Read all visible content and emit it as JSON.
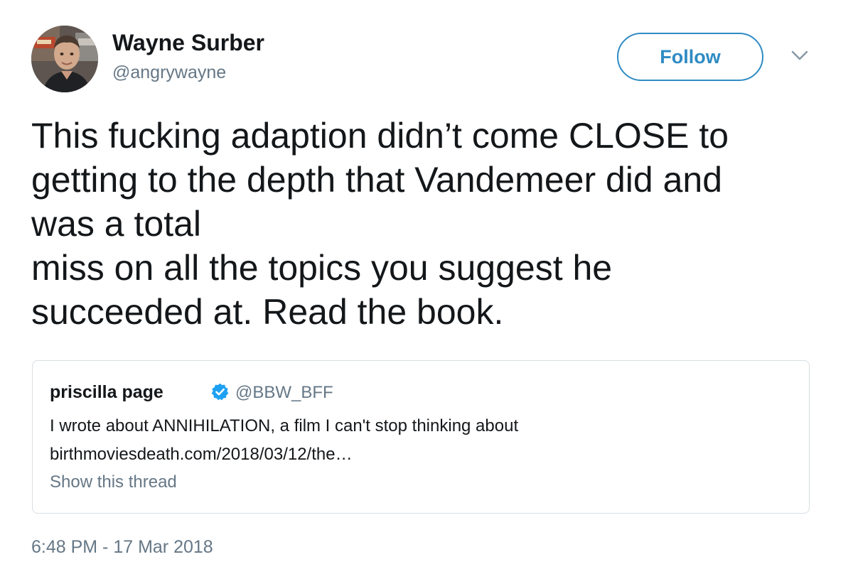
{
  "author": {
    "display_name": "Wayne Surber",
    "handle": "@angrywayne"
  },
  "follow_button": {
    "label": "Follow"
  },
  "menu_caret": {
    "icon": "chevron-down-icon"
  },
  "tweet": {
    "lines": [
      "This fucking adaption didn’t come CLOSE to",
      "getting to the depth that Vandemeer did and",
      "was a total",
      "miss on all the topics you suggest he",
      "succeeded at. Read the book."
    ],
    "timestamp": "6:48 PM - 17 Mar 2018"
  },
  "quoted_tweet": {
    "display_name": "priscilla page",
    "verified_icon": "verified-badge-icon",
    "handle": "@BBW_BFF",
    "text": "I wrote about ANNIHILATION, a film I can't stop thinking about",
    "link": "birthmoviesdeath.com/2018/03/12/the…",
    "show_thread": "Show this thread"
  },
  "colors": {
    "text": "#14171a",
    "secondary": "#657786",
    "accent": "#2f8bc4",
    "verified": "#1da1f2",
    "border": "#d8dee3"
  }
}
